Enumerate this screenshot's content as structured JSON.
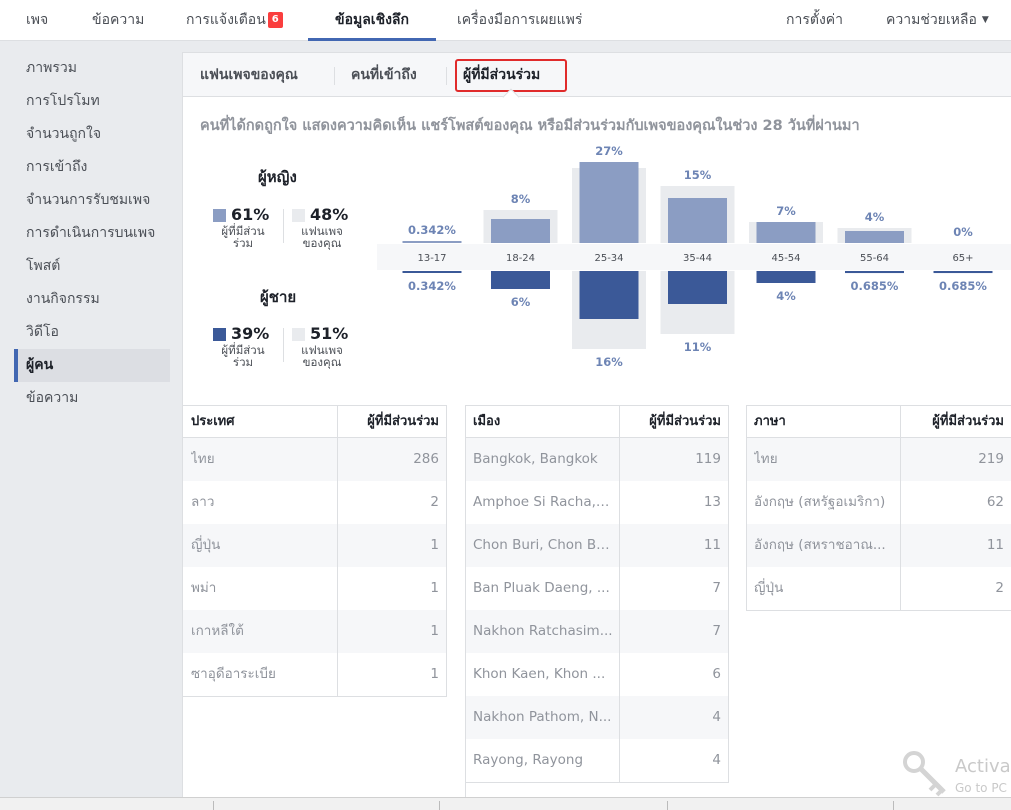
{
  "topnav": {
    "page": "เพจ",
    "messages": "ข้อความ",
    "notifications": "การแจ้งเตือน",
    "notifications_count": "6",
    "insights": "ข้อมูลเชิงลึก",
    "publishing_tools": "เครื่องมือการเผยแพร่",
    "settings": "การตั้งค่า",
    "help": "ความช่วยเหลือ"
  },
  "sidebar": {
    "items": [
      "ภาพรวม",
      "การโปรโมท",
      "จำนวนถูกใจ",
      "การเข้าถึง",
      "จำนวนการรับชมเพจ",
      "การดำเนินการบนเพจ",
      "โพสต์",
      "งานกิจกรรม",
      "วิดีโอ",
      "ผู้คน",
      "ข้อความ"
    ],
    "active": "ผู้คน"
  },
  "subtabs": [
    "แฟนเพจของคุณ",
    "คนที่เข้าถึง",
    "ผู้ที่มีส่วนร่วม"
  ],
  "heading": "คนที่ได้กดถูกใจ แสดงความคิดเห็น แชร์โพสต์ของคุณ หรือมีส่วนร่วมกับเพจของคุณในช่วง 28 วันที่ผ่านมา",
  "legend": {
    "women": {
      "title": "ผู้หญิง",
      "engaged_pct": "61%",
      "engaged_label_1": "ผู้ที่มีส่วน",
      "engaged_label_2": "ร่วม",
      "fans_pct": "48%",
      "fans_label_1": "แฟนเพจ",
      "fans_label_2": "ของคุณ"
    },
    "men": {
      "title": "ผู้ชาย",
      "engaged_pct": "39%",
      "engaged_label_1": "ผู้ที่มีส่วน",
      "engaged_label_2": "ร่วม",
      "fans_pct": "51%",
      "fans_label_1": "แฟนเพจ",
      "fans_label_2": "ของคุณ"
    }
  },
  "colors": {
    "women": "#8b9dc3",
    "men": "#3b5998",
    "fans": "#e9ebee",
    "accent": "#4267b2",
    "highlight": "#e02b2b"
  },
  "chart_data": {
    "type": "bar",
    "categories": [
      "13-17",
      "18-24",
      "25-34",
      "35-44",
      "45-54",
      "55-64",
      "65+"
    ],
    "series": [
      {
        "name": "ผู้หญิง",
        "values": [
          0.342,
          8,
          27,
          15,
          7,
          4,
          0
        ],
        "labels": [
          "0.342%",
          "8%",
          "27%",
          "15%",
          "7%",
          "4%",
          "0%"
        ]
      },
      {
        "name": "ผู้ชาย",
        "values": [
          0.342,
          6,
          16,
          11,
          4,
          0.685,
          0.685
        ],
        "labels": [
          "0.342%",
          "6%",
          "16%",
          "11%",
          "4%",
          "0.685%",
          "0.685%"
        ]
      }
    ],
    "fans_background_women": [
      0,
      8,
      22,
      16,
      4,
      2,
      0
    ],
    "fans_background_men": [
      0,
      0,
      23,
      18,
      0,
      0,
      0
    ]
  },
  "tables": {
    "country": {
      "headers": [
        "ประเทศ",
        "ผู้ที่มีส่วนร่วม"
      ],
      "rows": [
        [
          "ไทย",
          "286"
        ],
        [
          "ลาว",
          "2"
        ],
        [
          "ญี่ปุ่น",
          "1"
        ],
        [
          "พม่า",
          "1"
        ],
        [
          "เกาหลีใต้",
          "1"
        ],
        [
          "ซาอุดีอาระเบีย",
          "1"
        ]
      ]
    },
    "city": {
      "headers": [
        "เมือง",
        "ผู้ที่มีส่วนร่วม"
      ],
      "rows": [
        [
          "Bangkok, Bangkok",
          "119"
        ],
        [
          "Amphoe Si Racha, ...",
          "13"
        ],
        [
          "Chon Buri, Chon Buri",
          "11"
        ],
        [
          "Ban Pluak Daeng, ...",
          "7"
        ],
        [
          "Nakhon Ratchasim...",
          "7"
        ],
        [
          "Khon Kaen, Khon ...",
          "6"
        ],
        [
          "Nakhon Pathom, N...",
          "4"
        ],
        [
          "Rayong, Rayong",
          "4"
        ]
      ]
    },
    "language": {
      "headers": [
        "ภาษา",
        "ผู้ที่มีส่วนร่วม"
      ],
      "rows": [
        [
          "ไทย",
          "219"
        ],
        [
          "อังกฤษ (สหรัฐอเมริกา)",
          "62"
        ],
        [
          "อังกฤษ (สหราชอาณ...",
          "11"
        ],
        [
          "ญี่ปุ่น",
          "2"
        ]
      ]
    }
  },
  "watermark": {
    "line1": "Activa",
    "line2": "Go to PC"
  }
}
